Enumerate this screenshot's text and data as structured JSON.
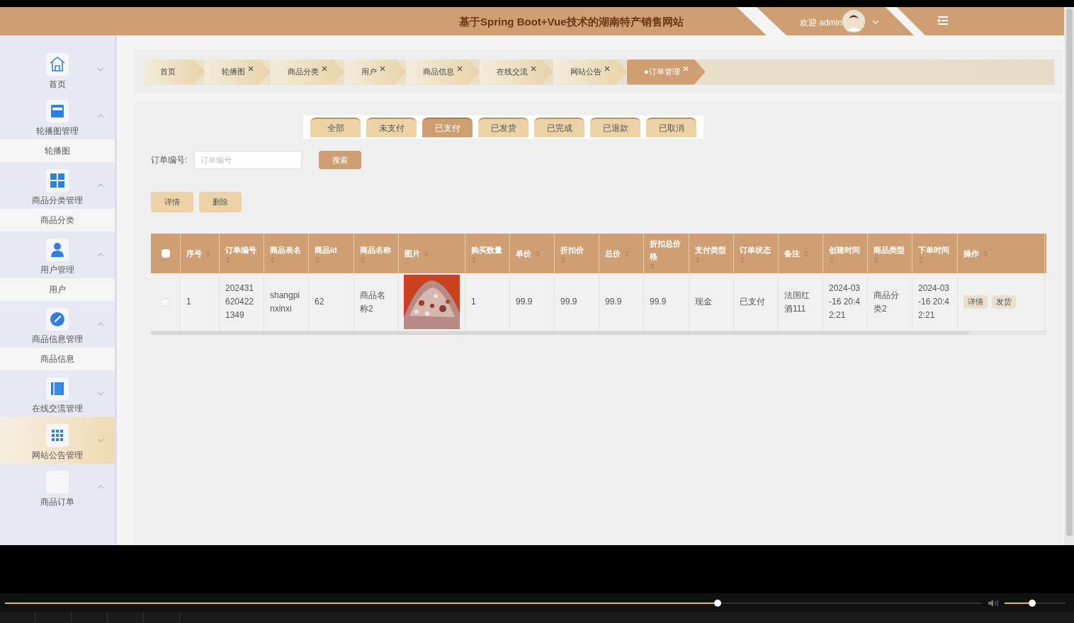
{
  "header": {
    "title": "基于Spring Boot+Vue技术的湖南特产销售网站",
    "welcome": "欢迎 admin"
  },
  "sidebar": {
    "items": [
      {
        "label": "首页",
        "expanded": false,
        "selected": false
      },
      {
        "label": "轮播图管理",
        "expanded": true,
        "selected": false,
        "children": [
          {
            "label": "轮播图"
          }
        ]
      },
      {
        "label": "商品分类管理",
        "expanded": true,
        "selected": false,
        "children": [
          {
            "label": "商品分类"
          }
        ]
      },
      {
        "label": "用户管理",
        "expanded": true,
        "selected": false,
        "children": [
          {
            "label": "用户"
          }
        ]
      },
      {
        "label": "商品信息管理",
        "expanded": true,
        "selected": false,
        "children": [
          {
            "label": "商品信息"
          }
        ]
      },
      {
        "label": "在线交流管理",
        "expanded": false,
        "selected": false
      },
      {
        "label": "网站公告管理",
        "expanded": false,
        "selected": true
      },
      {
        "label": "商品订单",
        "expanded": true,
        "selected": false
      }
    ]
  },
  "tabs": [
    {
      "label": "首页",
      "closable": false,
      "selected": false
    },
    {
      "label": "轮播图",
      "closable": true,
      "selected": false
    },
    {
      "label": "商品分类",
      "closable": true,
      "selected": false
    },
    {
      "label": "用户",
      "closable": true,
      "selected": false
    },
    {
      "label": "商品信息",
      "closable": true,
      "selected": false
    },
    {
      "label": "在线交流",
      "closable": true,
      "selected": false
    },
    {
      "label": "网站公告",
      "closable": true,
      "selected": false
    },
    {
      "label": "●订单管理",
      "closable": true,
      "selected": true
    }
  ],
  "status_filters": [
    {
      "label": "全部",
      "selected": false
    },
    {
      "label": "未支付",
      "selected": false
    },
    {
      "label": "已支付",
      "selected": true
    },
    {
      "label": "已发货",
      "selected": false
    },
    {
      "label": "已完成",
      "selected": false
    },
    {
      "label": "已退款",
      "selected": false
    },
    {
      "label": "已取消",
      "selected": false
    }
  ],
  "search": {
    "label": "订单编号:",
    "placeholder": "订单编号",
    "button": "搜索"
  },
  "actions": [
    "详情",
    "删除"
  ],
  "table": {
    "select_all": {
      "checked": false
    },
    "columns": [
      {
        "label": "序号",
        "kind": "text",
        "sortable": true
      },
      {
        "label": "订单编号",
        "kind": "text",
        "sortable": true
      },
      {
        "label": "商品表名",
        "kind": "text",
        "sortable": true
      },
      {
        "label": "商品id",
        "kind": "text",
        "sortable": true
      },
      {
        "label": "商品名称",
        "kind": "text",
        "sortable": true
      },
      {
        "label": "图片",
        "kind": "picture",
        "sortable": true
      },
      {
        "label": "购买数量",
        "kind": "text",
        "sortable": true
      },
      {
        "label": "单价",
        "kind": "text",
        "sortable": true
      },
      {
        "label": "折扣价",
        "kind": "text",
        "sortable": true
      },
      {
        "label": "总价",
        "kind": "text",
        "sortable": true
      },
      {
        "label": "折扣总价格",
        "kind": "text",
        "sortable": true
      },
      {
        "label": "支付类型",
        "kind": "text",
        "sortable": true
      },
      {
        "label": "订单状态",
        "kind": "text",
        "sortable": true
      },
      {
        "label": "备注",
        "kind": "text",
        "sortable": true
      },
      {
        "label": "创建时间",
        "kind": "text",
        "sortable": true
      },
      {
        "label": "商品类型",
        "kind": "text",
        "sortable": true
      },
      {
        "label": "下单时间",
        "kind": "text",
        "sortable": true
      },
      {
        "label": "操作",
        "kind": "actions",
        "sortable": true
      }
    ],
    "rows": [
      {
        "checked": false,
        "cells": [
          "1",
          "2024316204221349",
          "shangpinxinxi",
          "62",
          "商品名称2",
          "",
          "1",
          "99.9",
          "99.9",
          "99.9",
          "99.9",
          "现金",
          "已支付",
          "法国红酒111",
          "2024-03-16 20:42:21",
          "商品分类2",
          "2024-03-16 20:42:21"
        ],
        "actions": [
          "详情",
          "发货"
        ]
      }
    ]
  },
  "player": {
    "seek": {
      "level": 0.73
    },
    "volume": {
      "level": 0.45
    }
  }
}
